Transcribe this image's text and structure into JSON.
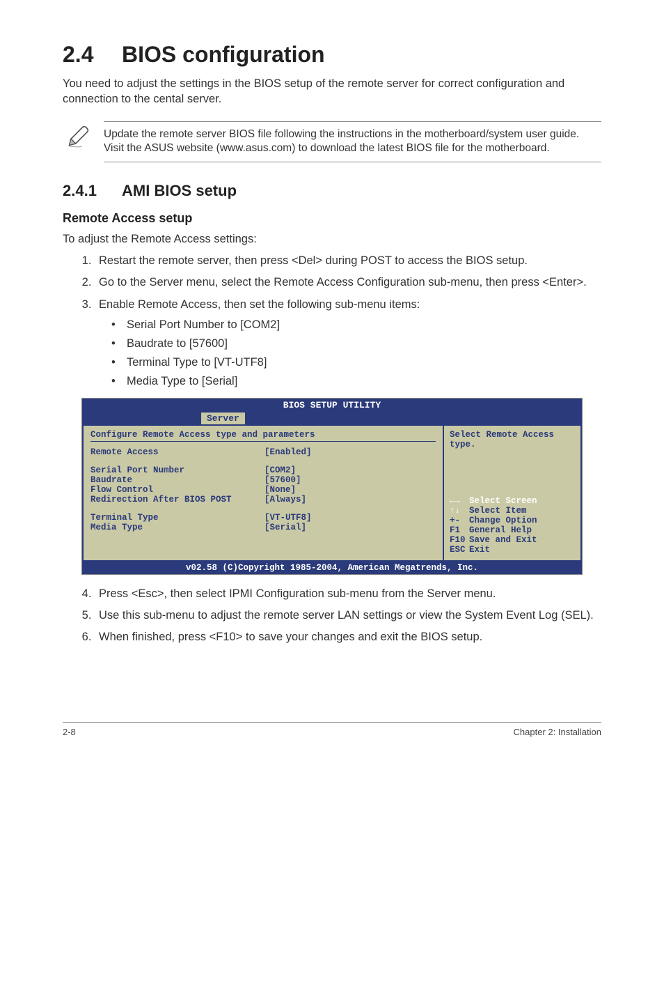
{
  "header": {
    "section_number": "2.4",
    "section_title": "BIOS configuration",
    "intro": "You need to adjust the settings in the BIOS setup of the remote server for correct configuration and connection to the cental server."
  },
  "note": {
    "text": "Update the remote server BIOS file following the instructions in the motherboard/system user guide. Visit the ASUS website (www.asus.com) to download the latest BIOS file for the motherboard."
  },
  "subsection": {
    "number": "2.4.1",
    "title": "AMI BIOS setup"
  },
  "topic": {
    "title": "Remote Access setup",
    "lead": "To adjust the Remote Access settings:"
  },
  "steps_a": [
    "Restart the remote server, then press <Del> during POST to access the BIOS setup.",
    "Go to the Server menu, select the Remote Access Configuration sub-menu, then press <Enter>.",
    "Enable Remote Access, then set the following sub-menu items:"
  ],
  "bullets": [
    "Serial Port Number to [COM2]",
    "Baudrate to [57600]",
    "Terminal Type to [VT-UTF8]",
    "Media Type to [Serial]"
  ],
  "bios": {
    "title": "BIOS SETUP UTILITY",
    "tab": "Server",
    "left_title": "Configure Remote Access type and parameters",
    "rows": [
      {
        "label": "Remote Access",
        "value": "[Enabled]"
      }
    ],
    "group1": [
      {
        "label": "Serial Port Number",
        "value": "[COM2]"
      },
      {
        "label": "Baudrate",
        "value": "[57600]"
      },
      {
        "label": "Flow Control",
        "value": "[None]"
      },
      {
        "label": "Redirection After BIOS POST",
        "value": "[Always]"
      }
    ],
    "group2": [
      {
        "label": "Terminal Type",
        "value": "[VT-UTF8]"
      },
      {
        "label": "Media Type",
        "value": "[Serial]"
      }
    ],
    "right_top": "Select Remote Access type.",
    "help": [
      {
        "key": "←→",
        "text": "Select Screen",
        "white": true
      },
      {
        "key": "↑↓",
        "text": "Select Item",
        "white": false
      },
      {
        "key": "+-",
        "text": "Change Option",
        "white": false
      },
      {
        "key": "F1",
        "text": "General Help",
        "white": false
      },
      {
        "key": "F10",
        "text": "Save and Exit",
        "white": false
      },
      {
        "key": "ESC",
        "text": "Exit",
        "white": false
      }
    ],
    "footer": "v02.58 (C)Copyright 1985-2004, American Megatrends, Inc."
  },
  "steps_b": [
    "Press <Esc>, then select IPMI Configuration sub-menu from the Server menu.",
    "Use this sub-menu to adjust the remote server LAN settings or view the System Event Log (SEL).",
    "When finished, press <F10> to save your changes and exit the BIOS setup."
  ],
  "footer": {
    "left": "2-8",
    "right": "Chapter 2: Installation"
  }
}
